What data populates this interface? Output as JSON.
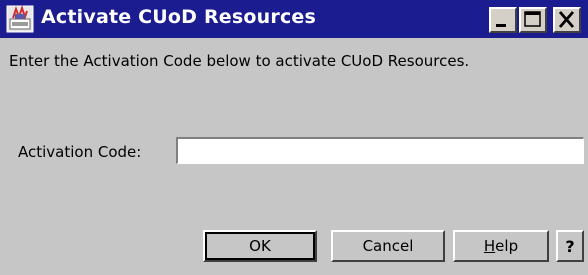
{
  "window": {
    "title": "Activate CUoD Resources",
    "icon": "application-icon",
    "controls": [
      "minimize-icon",
      "maximize-icon",
      "close-icon"
    ]
  },
  "dialog": {
    "instruction": "Enter the Activation Code below to activate CUoD Resources.",
    "activation_code": {
      "label": "Activation Code:",
      "value": "",
      "placeholder": ""
    }
  },
  "buttons": {
    "ok": "OK",
    "cancel": "Cancel",
    "help_mnemonic": "H",
    "help_rest": "elp",
    "context_help": "?"
  },
  "colors": {
    "titlebar": "#1c1c91",
    "dialog_bg": "#c6c6c6"
  }
}
